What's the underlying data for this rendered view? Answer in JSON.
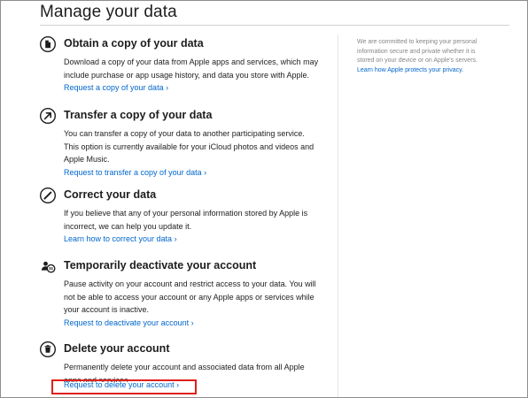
{
  "page": {
    "title": "Manage your data"
  },
  "sections": [
    {
      "icon": "document-icon",
      "title": "Obtain a copy of your data",
      "lines": [
        "Download a copy of your data from Apple apps and services, which may",
        "include purchase or app usage history, and data you store with Apple."
      ],
      "link": "Request a copy of your data ›"
    },
    {
      "icon": "arrow-up-right-icon",
      "title": "Transfer a copy of your data",
      "lines": [
        "You can transfer a copy of your data to another participating service.",
        "This option is currently available for your iCloud photos and videos and",
        "Apple Music."
      ],
      "link": "Request to transfer a copy of your data ›"
    },
    {
      "icon": "pencil-icon",
      "title": "Correct your data",
      "lines": [
        "If you believe that any of your personal information stored by Apple is",
        "incorrect, we can help you update it."
      ],
      "link": "Learn how to correct your data ›"
    },
    {
      "icon": "deactivate-account-icon",
      "title": "Temporarily deactivate your account",
      "lines": [
        "Pause activity on your account and restrict access to your data. You will",
        "not be able to access your account or any Apple apps or services while",
        "your account is inactive."
      ],
      "link": "Request to deactivate your account ›"
    },
    {
      "icon": "trash-icon",
      "title": "Delete your account",
      "lines": [
        "Permanently delete your account and associated data from all Apple",
        "apps and services."
      ],
      "link": "Request to delete your account ›"
    }
  ],
  "sidebar": {
    "lines": [
      "We are committed to keeping your personal",
      "information secure and private whether it is",
      "stored on your device or on Apple's servers."
    ],
    "link": "Learn how Apple protects your privacy."
  },
  "colors": {
    "link": "#0066cc",
    "highlight": "#e0201b",
    "text": "#1d1d1f"
  }
}
